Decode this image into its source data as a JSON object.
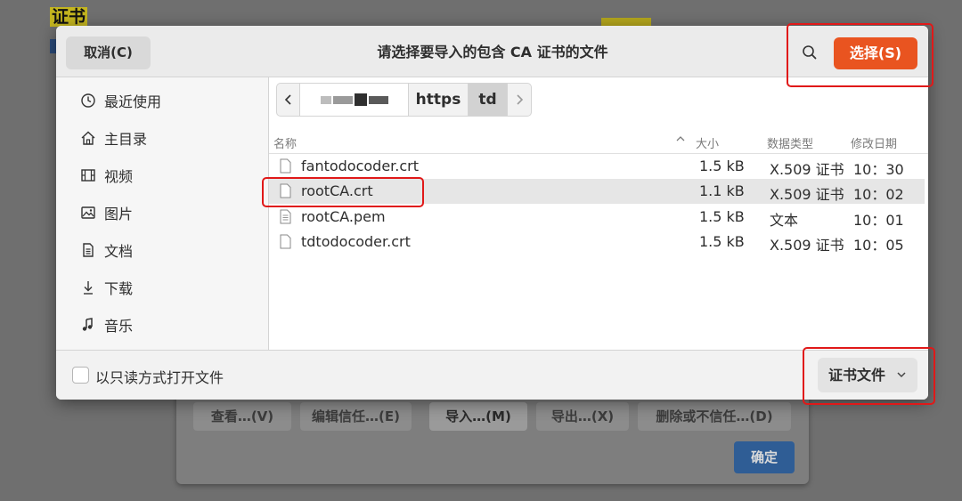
{
  "background": {
    "window_title": "证书",
    "buttons": [
      "查看…(V)",
      "编辑信任…(E)",
      "导入…(M)",
      "导出…(X)",
      "删除或不信任…(D)"
    ],
    "ok_label": "确定"
  },
  "dialog": {
    "title": "请选择要导入的包含 CA 证书的文件",
    "cancel_label": "取消(C)",
    "select_label": "选择(S)",
    "sidebar": [
      {
        "label": "最近使用",
        "icon": "clock-icon"
      },
      {
        "label": "主目录",
        "icon": "home-icon"
      },
      {
        "label": "视频",
        "icon": "film-icon"
      },
      {
        "label": "图片",
        "icon": "image-icon"
      },
      {
        "label": "文档",
        "icon": "document-icon"
      },
      {
        "label": "下载",
        "icon": "download-icon"
      },
      {
        "label": "音乐",
        "icon": "music-icon"
      }
    ],
    "path": [
      "https",
      "td"
    ],
    "columns": {
      "name": "名称",
      "size": "大小",
      "type": "数据类型",
      "modified": "修改日期"
    },
    "files": [
      {
        "name": "fantodocoder.crt",
        "size": "1.5 kB",
        "type": "X.509 证书",
        "modified": "10：30"
      },
      {
        "name": "rootCA.crt",
        "size": "1.1 kB",
        "type": "X.509 证书",
        "modified": "10：02"
      },
      {
        "name": "rootCA.pem",
        "size": "1.5 kB",
        "type": "文本",
        "modified": "10：01"
      },
      {
        "name": "tdtodocoder.crt",
        "size": "1.5 kB",
        "type": "X.509 证书",
        "modified": "10：05"
      }
    ],
    "readonly_label": "以只读方式打开文件",
    "filter_label": "证书文件"
  },
  "colors": {
    "accent": "#e95420",
    "annotation": "#e01919",
    "selected_row": "#e6e6e6"
  }
}
